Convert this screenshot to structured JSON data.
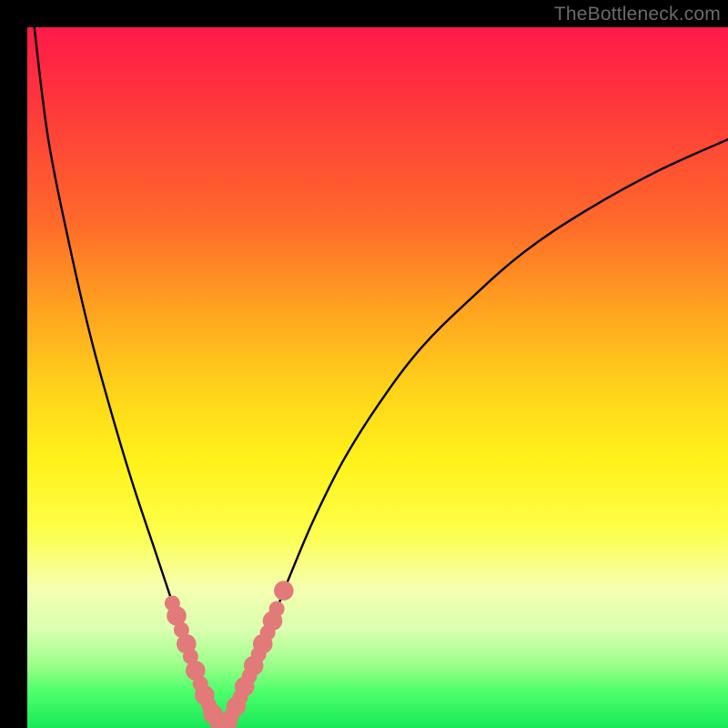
{
  "watermark": "TheBottleneck.com",
  "chart_data": {
    "type": "line",
    "title": "",
    "xlabel": "",
    "ylabel": "",
    "xlim": [
      0,
      100
    ],
    "ylim": [
      0,
      100
    ],
    "series": [
      {
        "name": "curve-left",
        "x": [
          1,
          3,
          6,
          9,
          12,
          15,
          18,
          20,
          22,
          23.5,
          25,
          26,
          27,
          27.6
        ],
        "values": [
          100,
          84,
          69,
          56,
          45,
          35,
          26,
          20,
          14,
          9.5,
          5.5,
          3,
          1.3,
          0.4
        ]
      },
      {
        "name": "curve-right",
        "x": [
          27.6,
          28.8,
          30,
          32,
          34,
          36,
          38,
          41,
          45,
          50,
          56,
          63,
          71,
          80,
          90,
          100
        ],
        "values": [
          0.4,
          1.2,
          3.5,
          8,
          13,
          18,
          23,
          30,
          38,
          46,
          54,
          61,
          68,
          74,
          79.5,
          84
        ]
      }
    ],
    "markers": {
      "name": "highlight-dots",
      "color": "#e27a7a",
      "points": [
        {
          "x": 20.7,
          "y": 17.8,
          "r": 1.1
        },
        {
          "x": 21.3,
          "y": 16.0,
          "r": 1.4
        },
        {
          "x": 22.0,
          "y": 14.0,
          "r": 1.1
        },
        {
          "x": 22.7,
          "y": 12.0,
          "r": 1.4
        },
        {
          "x": 23.3,
          "y": 10.2,
          "r": 1.1
        },
        {
          "x": 24.0,
          "y": 8.2,
          "r": 1.4
        },
        {
          "x": 24.7,
          "y": 6.3,
          "r": 1.1
        },
        {
          "x": 25.3,
          "y": 4.7,
          "r": 1.4
        },
        {
          "x": 25.9,
          "y": 3.3,
          "r": 1.1
        },
        {
          "x": 26.5,
          "y": 2.0,
          "r": 1.4
        },
        {
          "x": 27.0,
          "y": 1.1,
          "r": 1.1
        },
        {
          "x": 27.5,
          "y": 0.5,
          "r": 1.4
        },
        {
          "x": 28.0,
          "y": 0.4,
          "r": 1.1
        },
        {
          "x": 28.6,
          "y": 0.9,
          "r": 1.4
        },
        {
          "x": 29.2,
          "y": 1.9,
          "r": 1.1
        },
        {
          "x": 29.8,
          "y": 3.1,
          "r": 1.4
        },
        {
          "x": 30.4,
          "y": 4.4,
          "r": 1.1
        },
        {
          "x": 31.0,
          "y": 5.9,
          "r": 1.4
        },
        {
          "x": 31.7,
          "y": 7.4,
          "r": 1.1
        },
        {
          "x": 32.3,
          "y": 8.9,
          "r": 1.4
        },
        {
          "x": 33.0,
          "y": 10.5,
          "r": 1.1
        },
        {
          "x": 33.6,
          "y": 12.0,
          "r": 1.4
        },
        {
          "x": 34.3,
          "y": 13.6,
          "r": 1.1
        },
        {
          "x": 35.0,
          "y": 15.3,
          "r": 1.4
        },
        {
          "x": 35.6,
          "y": 17.0,
          "r": 1.1
        },
        {
          "x": 36.6,
          "y": 19.6,
          "r": 1.4
        }
      ]
    },
    "background_gradient": {
      "top": "#ff1a49",
      "mid": "#fff21a",
      "bottom": "#18e858"
    }
  }
}
